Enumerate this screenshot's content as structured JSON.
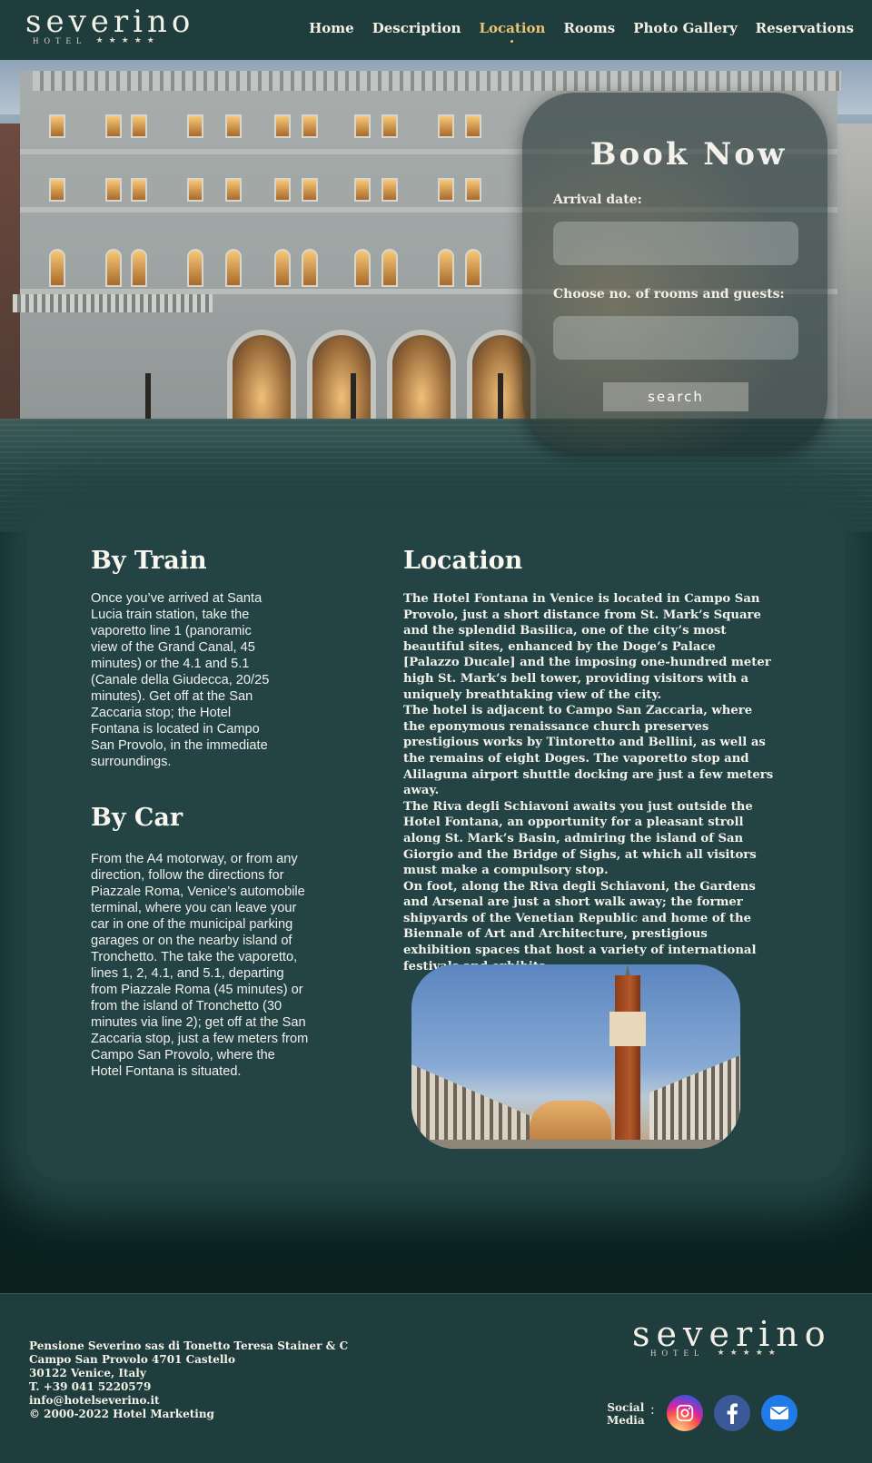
{
  "brand": {
    "name": "severino",
    "sub": "HOTEL",
    "stars": "★★★★★"
  },
  "nav": {
    "items": [
      "Home",
      "Description",
      "Location",
      "Rooms",
      "Photo Gallery",
      "Reservations"
    ],
    "active": "Location"
  },
  "booking": {
    "title": "Book Now",
    "arrival_label": "Arrival date:",
    "arrival_value": "",
    "rooms_label": "Choose no. of rooms and guests:",
    "rooms_value": "",
    "search_label": "search"
  },
  "train": {
    "title": "By Train",
    "text": "Once you’ve arrived at Santa Lucia train station, take the vaporetto line 1 (panoramic view of the Grand Canal, 45 minutes) or the 4.1 and 5.1 (Canale della Giudecca, 20/25 minutes). Get off at the San Zaccaria stop; the Hotel Fontana is located in Campo San Provolo, in the immediate surroundings."
  },
  "car": {
    "title": "By Car",
    "text": "From the A4 motorway, or from any direction, follow the directions for Piazzale Roma, Venice’s automobile terminal, where you can leave your car in one of the municipal parking garages or on the nearby island of Tronchetto. The take the vaporetto, lines 1, 2, 4.1, and 5.1, departing from Piazzale Roma (45 minutes) or from the island of Tronchetto (30 minutes via line 2); get off at the San Zaccaria stop, just a few meters from Campo San Provolo, where the Hotel Fontana is situated."
  },
  "location": {
    "title": "Location",
    "paragraphs": [
      "The Hotel Fontana in Venice is located in Campo San Provolo, just a short distance from St. Mark’s Square and the splendid Basilica, one of the city’s most beautiful sites, enhanced by the Doge’s Palace [Palazzo Ducale] and the imposing one-hundred meter high St. Mark’s bell tower, providing visitors with a uniquely breathtaking view of the city.",
      "The hotel is adjacent to Campo San Zaccaria, where the eponymous renaissance church preserves prestigious works by Tintoretto and Bellini, as well as the remains of eight Doges. The vaporetto stop and Alilaguna airport shuttle docking are just a few meters away.",
      "The Riva degli Schiavoni awaits you just outside the Hotel Fontana, an opportunity for a pleasant stroll along St. Mark’s Basin, admiring the island of San Giorgio and the Bridge of Sighs, at which all visitors must make a compulsory stop.",
      "On foot, along the Riva degli Schiavoni, the Gardens and Arsenal are just a short walk away; the former shipyards of the Venetian Republic and home of the Biennale of Art and Architecture, prestigious exhibition spaces that host a variety of international festivals and exhibits."
    ]
  },
  "footer": {
    "lines": [
      "Pensione Severino sas di Tonetto Teresa Stainer & C",
      "Campo San Provolo 4701 Castello",
      "30122 Venice, Italy",
      "T. +39 041 5220579",
      "info@hotelseverino.it",
      "© 2000-2022 Hotel Marketing"
    ],
    "social_label_1": "Social",
    "social_label_2": "Media",
    "social_colon": ":"
  },
  "icons": [
    "instagram-icon",
    "facebook-icon",
    "mail-icon"
  ],
  "colors": {
    "header": "#1f3d3d",
    "panel": "#234344",
    "accent": "#e7c574"
  }
}
